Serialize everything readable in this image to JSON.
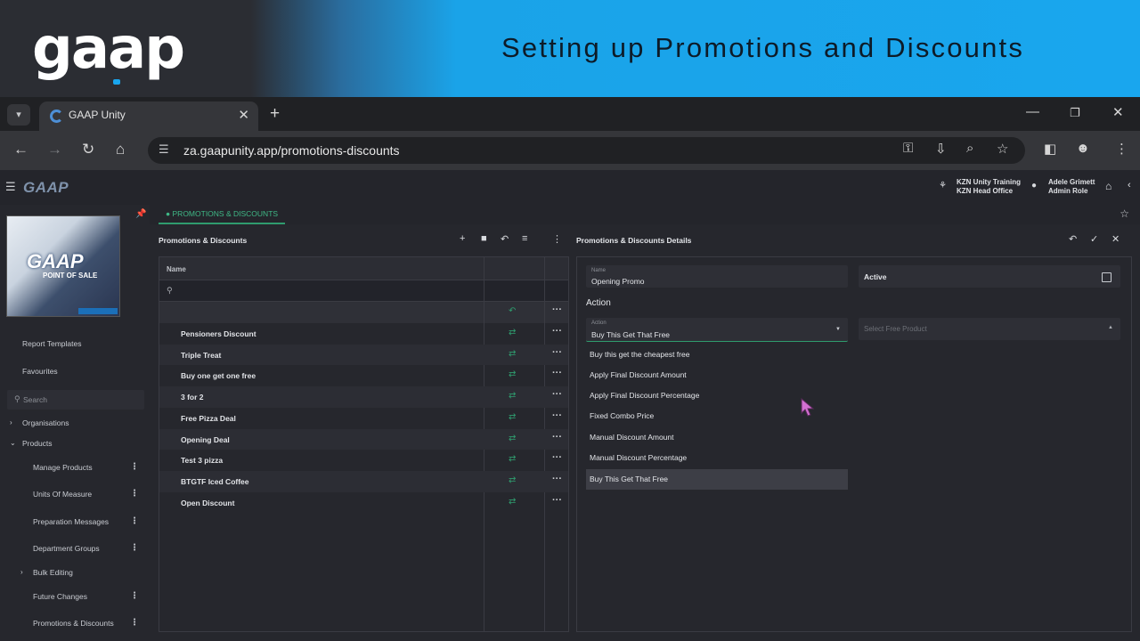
{
  "banner": {
    "logo": "gaap",
    "title": "Setting up Promotions and Discounts"
  },
  "browser": {
    "tab_title": "GAAP Unity",
    "url": "za.gaapunity.app/promotions-discounts"
  },
  "app": {
    "logo": "GAAP",
    "org_line1": "KZN Unity Training",
    "org_line2": "KZN Head Office",
    "user_name": "Adele Grimett",
    "user_role": "Admin Role",
    "active_tab": "PROMOTIONS & DISCOUNTS"
  },
  "sidebar": {
    "image_title": "GAAP",
    "image_subtitle": "POINT OF SALE",
    "report_templates": "Report Templates",
    "favourites": "Favourites",
    "search_placeholder": "Search",
    "organisations": "Organisations",
    "products": "Products",
    "sub_items": [
      "Manage Products",
      "Units Of Measure",
      "Preparation Messages",
      "Department Groups",
      "Bulk Editing",
      "Future Changes",
      "Promotions & Discounts"
    ]
  },
  "list_panel": {
    "title": "Promotions & Discounts",
    "column_name": "Name",
    "rows": [
      "Pensioners Discount",
      "Triple Treat",
      "Buy one get one free",
      "3 for 2",
      "Free Pizza Deal",
      "Opening Deal",
      "Test 3 pizza",
      "BTGTF Iced Coffee",
      "Open Discount"
    ]
  },
  "detail_panel": {
    "title": "Promotions & Discounts Details",
    "name_label": "Name",
    "name_value": "Opening Promo",
    "active_label": "Active",
    "action_section": "Action",
    "action_label": "Action",
    "action_value": "Buy This Get That Free",
    "free_product_placeholder": "Select Free Product",
    "action_options": [
      "Buy this get the cheapest free",
      "Apply Final Discount Amount",
      "Apply Final Discount Percentage",
      "Fixed Combo Price",
      "Manual Discount Amount",
      "Manual Discount Percentage",
      "Buy This Get That Free"
    ]
  },
  "colors": {
    "accent": "#2f9c6e",
    "banner_blue": "#19a6ee",
    "panel_bg": "#26272d"
  }
}
